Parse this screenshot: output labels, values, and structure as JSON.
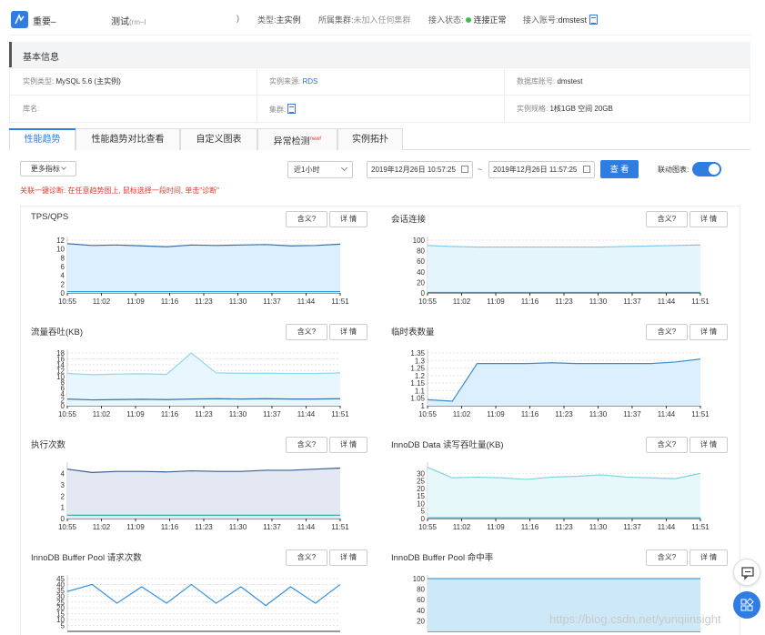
{
  "header": {
    "title": "重要–",
    "name": "测试",
    "name_suffix": "(rm–l",
    "name_close": ")",
    "type_label": "类型:",
    "type_value": "主实例",
    "cluster_label": "所属集群:",
    "cluster_value": "未加入任何集群",
    "status_label": "接入状态:",
    "status_value": "连接正常",
    "account_label": "接入账号:",
    "account_value": "dmstest",
    "status_color": "#45b854"
  },
  "basic": {
    "title": "基本信息",
    "fields": [
      {
        "label": "实例类型:",
        "value": "MySQL 5.6 (主实例)"
      },
      {
        "label": "实例来源:",
        "value": "RDS"
      },
      {
        "label": "数据库账号:",
        "value": "dmstest"
      },
      {
        "label": "库名:",
        "value": ""
      },
      {
        "label": "集群:",
        "value": ""
      },
      {
        "label": "实例规格:",
        "value": "1核1GB 空间 20GB"
      }
    ]
  },
  "tabs": [
    {
      "label": "性能趋势",
      "active": true
    },
    {
      "label": "性能趋势对比查看"
    },
    {
      "label": "自定义图表"
    },
    {
      "label": "异常检测",
      "badge": "new!"
    },
    {
      "label": "实例拓扑"
    }
  ],
  "toolbar": {
    "more_label": "更多指标",
    "range_value": "近1小时",
    "start_time": "2019年12月26日 10:57:25",
    "separator": "~",
    "end_time": "2019年12月26日 11:57:25",
    "view_label": "查 看",
    "linked_label": "联动图表:",
    "linked_on": true
  },
  "hint": "关联一键诊断: 在任意趋势图上, 鼠标选择一段时间, 单击\"诊断\"",
  "chart_buttons": {
    "meaning": "含义?",
    "detail": "详 情"
  },
  "chart_data": [
    {
      "type": "area",
      "title": "TPS/QPS",
      "x": [
        "10:55",
        "11:02",
        "11:09",
        "11:16",
        "11:23",
        "11:30",
        "11:37",
        "11:44",
        "11:51"
      ],
      "yticks": [
        0,
        2,
        4,
        6,
        8,
        10,
        12
      ],
      "ylim": [
        0,
        12
      ],
      "series": [
        {
          "values": [
            11.2,
            10.8,
            10.9,
            10.7,
            10.5,
            10.9,
            10.8,
            10.9,
            11.0,
            10.7,
            10.8,
            11.1
          ]
        },
        {
          "values": [
            0.3,
            0.3,
            0.3,
            0.3,
            0.3,
            0.3,
            0.3,
            0.3,
            0.3,
            0.3,
            0.3,
            0.3
          ]
        }
      ],
      "colors": [
        "#3a6fa6",
        "#1a9fd8"
      ],
      "fill": "#dcefff"
    },
    {
      "type": "area",
      "title": "会话连接",
      "x": [
        "10:55",
        "11:02",
        "11:09",
        "11:16",
        "11:23",
        "11:30",
        "11:37",
        "11:44",
        "11:51"
      ],
      "yticks": [
        0,
        20,
        40,
        60,
        80,
        100
      ],
      "ylim": [
        0,
        100
      ],
      "series": [
        {
          "values": [
            90,
            88,
            87,
            87,
            87,
            87,
            87,
            87,
            88,
            89,
            90,
            91
          ]
        },
        {
          "values": [
            1,
            1,
            1,
            1,
            1,
            1,
            1,
            1,
            1,
            1,
            1,
            1
          ]
        }
      ],
      "colors": [
        "#7fc6e8",
        "#1a9fd8"
      ],
      "fill": "#e4f5fc"
    },
    {
      "type": "area",
      "title": "流量吞吐(KB)",
      "x": [
        "10:55",
        "11:02",
        "11:09",
        "11:16",
        "11:23",
        "11:30",
        "11:37",
        "11:44",
        "11:51"
      ],
      "yticks": [
        0,
        2,
        4,
        6,
        8,
        10,
        12,
        14,
        16,
        18
      ],
      "ylim": [
        0,
        18
      ],
      "series": [
        {
          "values": [
            11,
            10.6,
            10.8,
            10.9,
            10.7,
            18,
            11.2,
            11.1,
            11.1,
            11.0,
            11.0,
            11.2
          ]
        },
        {
          "values": [
            2.3,
            2.0,
            2.1,
            2.2,
            2.1,
            2.3,
            2.4,
            2.3,
            2.4,
            2.3,
            2.3,
            2.4
          ]
        }
      ],
      "colors": [
        "#8fd6ee",
        "#3a6fa6"
      ],
      "fill": "#e8f7fd"
    },
    {
      "type": "area",
      "title": "临时表数量",
      "x": [
        "10:55",
        "11:02",
        "11:09",
        "11:16",
        "11:23",
        "11:30",
        "11:37",
        "11:44",
        "11:51"
      ],
      "yticks": [
        1,
        1.05,
        1.1,
        1.15,
        1.2,
        1.25,
        1.3,
        1.35
      ],
      "ylim": [
        1,
        1.35
      ],
      "series": [
        {
          "values": [
            1.04,
            1.03,
            1.28,
            1.28,
            1.28,
            1.285,
            1.28,
            1.28,
            1.28,
            1.28,
            1.29,
            1.31
          ]
        }
      ],
      "colors": [
        "#3a8fc8"
      ],
      "fill": "#dcefff"
    },
    {
      "type": "area",
      "title": "执行次数",
      "x": [
        "10:55",
        "11:02",
        "11:09",
        "11:16",
        "11:23",
        "11:30",
        "11:37",
        "11:44",
        "11:51"
      ],
      "yticks": [
        0,
        1,
        2,
        3,
        4
      ],
      "ylim": [
        0,
        4.7
      ],
      "series": [
        {
          "values": [
            4.4,
            4.1,
            4.2,
            4.2,
            4.15,
            4.25,
            4.2,
            4.2,
            4.3,
            4.3,
            4.4,
            4.5
          ]
        },
        {
          "values": [
            0.3,
            0.3,
            0.3,
            0.3,
            0.3,
            0.3,
            0.3,
            0.3,
            0.3,
            0.3,
            0.3,
            0.3
          ]
        }
      ],
      "colors": [
        "#3a5f8a",
        "#2aa8a0"
      ],
      "fill": "#e3e8f2"
    },
    {
      "type": "area",
      "title": "InnoDB Data 读写吞吐量(KB)",
      "x": [
        "10:55",
        "11:02",
        "11:09",
        "11:16",
        "11:23",
        "11:30",
        "11:37",
        "11:44",
        "11:51"
      ],
      "yticks": [
        0,
        5,
        10,
        15,
        20,
        25,
        30
      ],
      "ylim": [
        0,
        35
      ],
      "series": [
        {
          "values": [
            34,
            27,
            27.5,
            27,
            26,
            27.5,
            28,
            29,
            27.5,
            27,
            26.5,
            30
          ]
        },
        {
          "values": [
            0.5,
            0.5,
            0.5,
            0.5,
            0.5,
            0.5,
            0.5,
            0.5,
            0.5,
            0.5,
            0.5,
            0.5
          ]
        }
      ],
      "colors": [
        "#7fd3e0",
        "#1a9fd8"
      ],
      "fill": "#e6f8fa"
    },
    {
      "type": "line",
      "title": "InnoDB Buffer Pool 请求次数",
      "x": [],
      "yticks": [
        5,
        10,
        15,
        20,
        25,
        30,
        35,
        40,
        45
      ],
      "ylim": [
        0,
        45
      ],
      "series": [
        {
          "values": [
            34,
            40,
            24,
            38,
            24,
            40,
            24,
            38,
            22,
            38,
            24,
            40
          ]
        }
      ],
      "colors": [
        "#2f8fe0"
      ],
      "fill": "none"
    },
    {
      "type": "area",
      "title": "InnoDB Buffer Pool 命中率",
      "x": [],
      "yticks": [
        20,
        40,
        60,
        80,
        100
      ],
      "ylim": [
        0,
        100
      ],
      "series": [
        {
          "values": [
            100,
            100,
            100,
            100,
            100,
            100,
            100,
            100,
            100,
            100,
            100,
            100
          ]
        }
      ],
      "colors": [
        "#4a9fd0"
      ],
      "fill": "#cde9f8"
    }
  ],
  "watermark": "https://blog.csdn.net/yunqiinsight",
  "icons": [
    "logo-icon",
    "doc-icon",
    "calendar-icon",
    "chat-icon",
    "apps-icon"
  ]
}
